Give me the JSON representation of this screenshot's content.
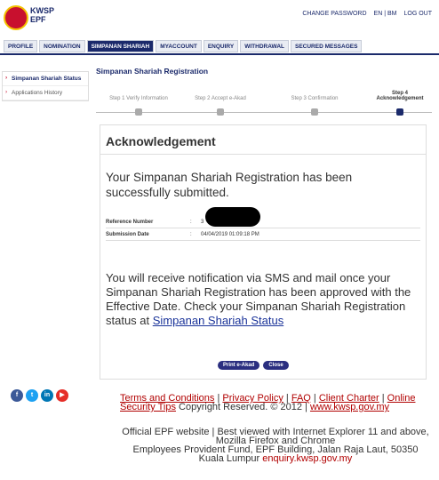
{
  "header": {
    "logo_line1": "KWSP",
    "logo_line2": "EPF",
    "change_password": "CHANGE PASSWORD",
    "language": "EN | BM",
    "logout": "LOG OUT"
  },
  "nav": {
    "tabs": [
      {
        "label": "PROFILE"
      },
      {
        "label": "NOMINATION"
      },
      {
        "label": "SIMPANAN SHARIAH"
      },
      {
        "label": "MYACCOUNT"
      },
      {
        "label": "ENQUIRY"
      },
      {
        "label": "WITHDRAWAL"
      },
      {
        "label": "SECURED MESSAGES"
      }
    ],
    "active": "SIMPANAN SHARIAH"
  },
  "sidebar": {
    "items": [
      {
        "label": "Simpanan Shariah Status"
      },
      {
        "label": "Applications History"
      }
    ]
  },
  "main": {
    "title": "Simpanan Shariah Registration",
    "steps": [
      {
        "label": "Step 1 Verify Information"
      },
      {
        "label": "Step 2 Accept e-Akad"
      },
      {
        "label": "Step 3 Confirmation"
      },
      {
        "label": "Step 4 Acknowledgement"
      }
    ],
    "active_step": 4
  },
  "card": {
    "title": "Acknowledgement",
    "message": "Your Simpanan Shariah Registration has been successfully submitted.",
    "reference_label": "Reference Number",
    "reference_value": "3",
    "date_label": "Submission Date",
    "date_value": "04/04/2019 01:09:18 PM",
    "colon": ":",
    "notice": "You will receive notification via SMS and mail once your Simpanan Shariah Registration has been approved with the Effective Date.",
    "check_text": "Check your Simpanan Shariah Registration status at",
    "status_link": "Simpanan Shariah Status",
    "print_button": "Print e-Akad",
    "close_button": "Close"
  },
  "social": {
    "icons": [
      "facebook-icon",
      "twitter-icon",
      "linkedin-icon",
      "youtube-icon"
    ]
  },
  "footer": {
    "terms": "Terms and Conditions",
    "privacy": "Privacy Policy",
    "faq": "FAQ",
    "client_charter": "Client Charter",
    "online_security": "Online Security Tips",
    "copyright": "Copyright Reserved. © 2012 |",
    "website": "www.kwsp.gov.my",
    "official": "Official EPF website | Best viewed with Internet Explorer 11 and above, Mozilla Firefox and Chrome",
    "address": "Employees Provident Fund, EPF Building, Jalan Raja Laut, 50350 Kuala Lumpur",
    "enquiry": "enquiry.kwsp.gov.my",
    "pipe": "|"
  },
  "colors": {
    "brand_navy": "#1b2a6b",
    "brand_red": "#c8102e",
    "button": "#2b2f80",
    "link_red": "#b10000"
  }
}
